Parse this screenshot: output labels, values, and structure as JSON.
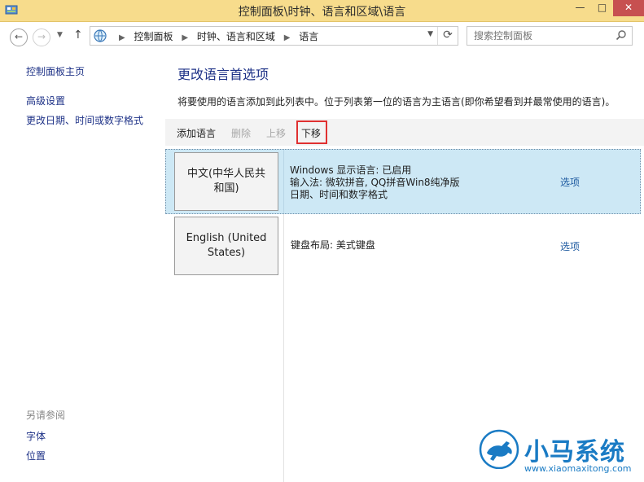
{
  "window": {
    "title": "控制面板\\时钟、语言和区域\\语言",
    "controls": {
      "minimize": "—",
      "maximize": "□",
      "close": "✕"
    }
  },
  "address_bar": {
    "breadcrumbs": [
      "控制面板",
      "时钟、语言和区域",
      "语言"
    ],
    "separator": "▶",
    "search_placeholder": "搜索控制面板"
  },
  "sidebar": {
    "links": [
      "控制面板主页",
      "高级设置",
      "更改日期、时间或数字格式"
    ],
    "see_also_title": "另请参阅",
    "see_also_links": [
      "字体",
      "位置"
    ]
  },
  "main": {
    "heading": "更改语言首选项",
    "description": "将要使用的语言添加到此列表中。位于列表第一位的语言为主语言(即你希望看到并最常使用的语言)。",
    "toolbar": {
      "add": "添加语言",
      "remove": "删除",
      "move_up": "上移",
      "move_down": "下移"
    },
    "languages": [
      {
        "name_line1": "中文(中华人民共",
        "name_line2": "和国)",
        "details": [
          "Windows 显示语言: 已启用",
          "输入法: 微软拼音, QQ拼音Win8纯净版",
          "日期、时间和数字格式"
        ],
        "options": "选项",
        "selected": true
      },
      {
        "name_line1": "English (United",
        "name_line2": "States)",
        "details": [
          "键盘布局: 美式键盘"
        ],
        "options": "选项",
        "selected": false
      }
    ]
  },
  "watermark": {
    "brand": "小马系统",
    "url": "www.xiaomaxitong.com"
  },
  "colors": {
    "titlebar": "#f7dc8c",
    "link": "#1e3287",
    "selected_row": "#cde8f5",
    "highlight_box": "#e03030",
    "watermark": "#1a7bc4"
  }
}
